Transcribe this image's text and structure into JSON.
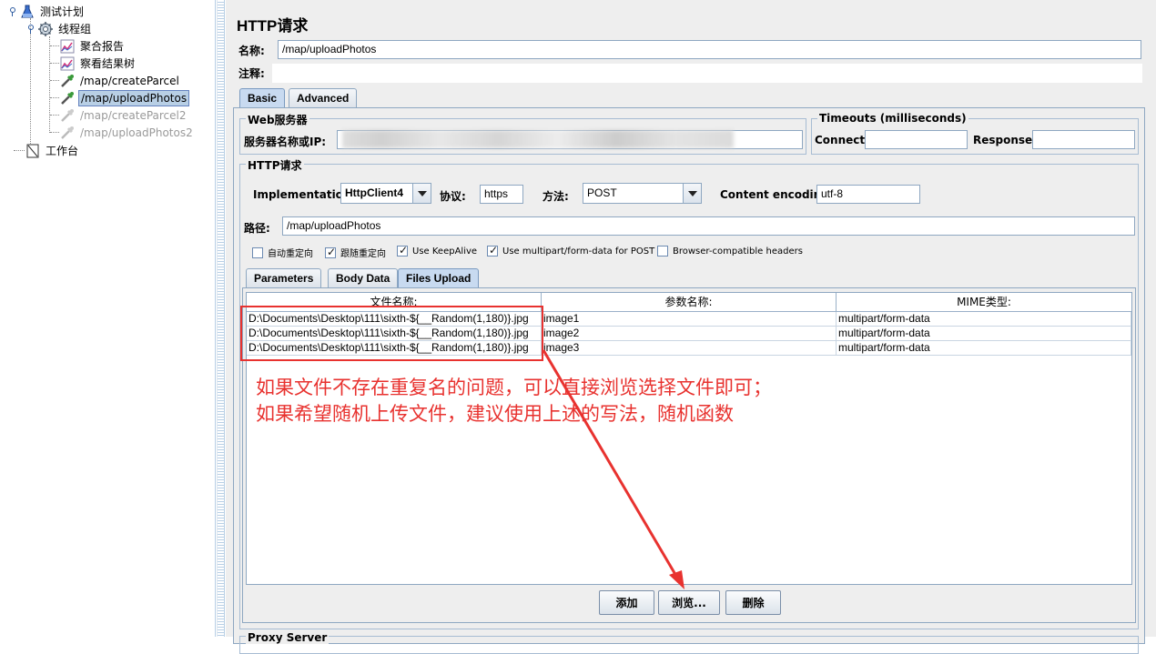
{
  "tree": {
    "items": [
      {
        "label": "测试计划",
        "icon": "flask-icon",
        "state": "normal"
      },
      {
        "label": "线程组",
        "icon": "gear-icon",
        "state": "normal"
      },
      {
        "label": "聚合报告",
        "icon": "chart-icon",
        "state": "normal"
      },
      {
        "label": "察看结果树",
        "icon": "chart-icon",
        "state": "normal"
      },
      {
        "label": "/map/createParcel",
        "icon": "pipette-icon",
        "state": "normal"
      },
      {
        "label": "/map/uploadPhotos",
        "icon": "pipette-icon",
        "state": "selected"
      },
      {
        "label": "/map/createParcel2",
        "icon": "pipette-icon",
        "state": "disabled"
      },
      {
        "label": "/map/uploadPhotos2",
        "icon": "pipette-icon",
        "state": "disabled"
      },
      {
        "label": "工作台",
        "icon": "workbench-icon",
        "state": "normal"
      }
    ]
  },
  "panel": {
    "title": "HTTP请求",
    "name_label": "名称:",
    "name_value": "/map/uploadPhotos",
    "comment_label": "注释:",
    "comment_value": ""
  },
  "tabs": {
    "basic": "Basic",
    "advanced": "Advanced"
  },
  "web_server": {
    "group_title": "Web服务器",
    "server_label": "服务器名称或IP:",
    "server_value": ""
  },
  "timeouts": {
    "group_title": "Timeouts (milliseconds)",
    "connect_label": "Connect:",
    "connect_value": "",
    "response_label": "Response:",
    "response_value": ""
  },
  "http_request": {
    "group_title": "HTTP请求",
    "implementation_label": "Implementation:",
    "implementation_value": "HttpClient4",
    "protocol_label": "协议:",
    "protocol_value": "https",
    "method_label": "方法:",
    "method_value": "POST",
    "encoding_label": "Content encoding:",
    "encoding_value": "utf-8",
    "path_label": "路径:",
    "path_value": "/map/uploadPhotos"
  },
  "checkboxes": [
    {
      "label": "自动重定向",
      "checked": false
    },
    {
      "label": "跟随重定向",
      "checked": true
    },
    {
      "label": "Use KeepAlive",
      "checked": true
    },
    {
      "label": "Use multipart/form-data for POST",
      "checked": true
    },
    {
      "label": "Browser-compatible headers",
      "checked": false
    }
  ],
  "subtabs": {
    "parameters": "Parameters",
    "body_data": "Body Data",
    "files_upload": "Files Upload"
  },
  "files_table": {
    "headers": [
      "文件名称:",
      "参数名称:",
      "MIME类型:"
    ],
    "rows": [
      [
        "D:\\Documents\\Desktop\\111\\sixth-${__Random(1,180)}.jpg",
        "image1",
        "multipart/form-data"
      ],
      [
        "D:\\Documents\\Desktop\\111\\sixth-${__Random(1,180)}.jpg",
        "image2",
        "multipart/form-data"
      ],
      [
        "D:\\Documents\\Desktop\\111\\sixth-${__Random(1,180)}.jpg",
        "image3",
        "multipart/form-data"
      ]
    ]
  },
  "buttons": {
    "add": "添加",
    "browse": "浏览...",
    "delete": "删除"
  },
  "proxy": {
    "group_title": "Proxy Server"
  },
  "annotation": {
    "line1": "如果文件不存在重复名的问题，可以直接浏览选择文件即可；",
    "line2": "如果希望随机上传文件，建议使用上述的写法，随机函数",
    "color": "#e8322f"
  }
}
